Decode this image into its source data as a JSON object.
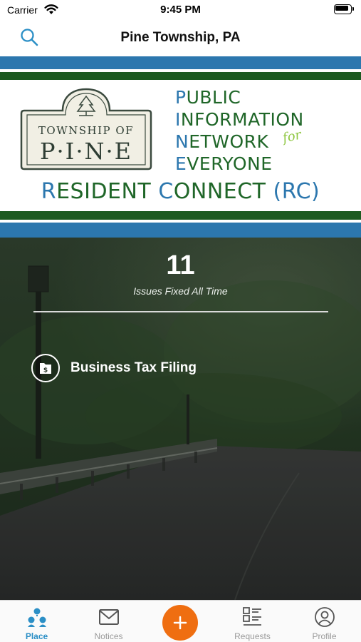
{
  "status_bar": {
    "carrier": "Carrier",
    "time": "9:45 PM",
    "icons": [
      "wifi-icon",
      "battery-icon"
    ]
  },
  "nav": {
    "title": "Pine Township, PA",
    "search_icon": "search-icon",
    "accent_color": "#2b8fc6"
  },
  "banner": {
    "logo_line1": "TOWNSHIP OF",
    "logo_line2": "P·I·N·E",
    "acronym": [
      {
        "initial": "P",
        "rest": "UBLIC"
      },
      {
        "initial": "I",
        "rest": "NFORMATION"
      },
      {
        "initial": "N",
        "rest": "ETWORK"
      },
      {
        "initial": "E",
        "rest": "VERYONE"
      }
    ],
    "for_text": "for",
    "title_parts": [
      {
        "initial": "R",
        "rest": "ESIDENT "
      },
      {
        "initial": "C",
        "rest": "ONNECT "
      },
      {
        "initial": "",
        "rest": "(RC)"
      }
    ],
    "colors": {
      "blue": "#2c77ae",
      "green": "#1c5a20",
      "lime": "#8dc63f"
    }
  },
  "hero": {
    "stat_value": "11",
    "stat_label": "Issues Fixed All Time",
    "quick_link_label": "Business Tax Filing",
    "quick_link_icon": "money-folder-icon"
  },
  "tab_bar": {
    "tabs": [
      {
        "label": "Place",
        "icon": "place-icon",
        "active": true
      },
      {
        "label": "Notices",
        "icon": "envelope-icon",
        "active": false
      },
      {
        "label": "Requests",
        "icon": "list-icon",
        "active": false
      },
      {
        "label": "Profile",
        "icon": "profile-icon",
        "active": false
      }
    ],
    "add_icon": "plus-icon",
    "add_color": "#ef6e11",
    "active_color": "#2b8fc6"
  }
}
